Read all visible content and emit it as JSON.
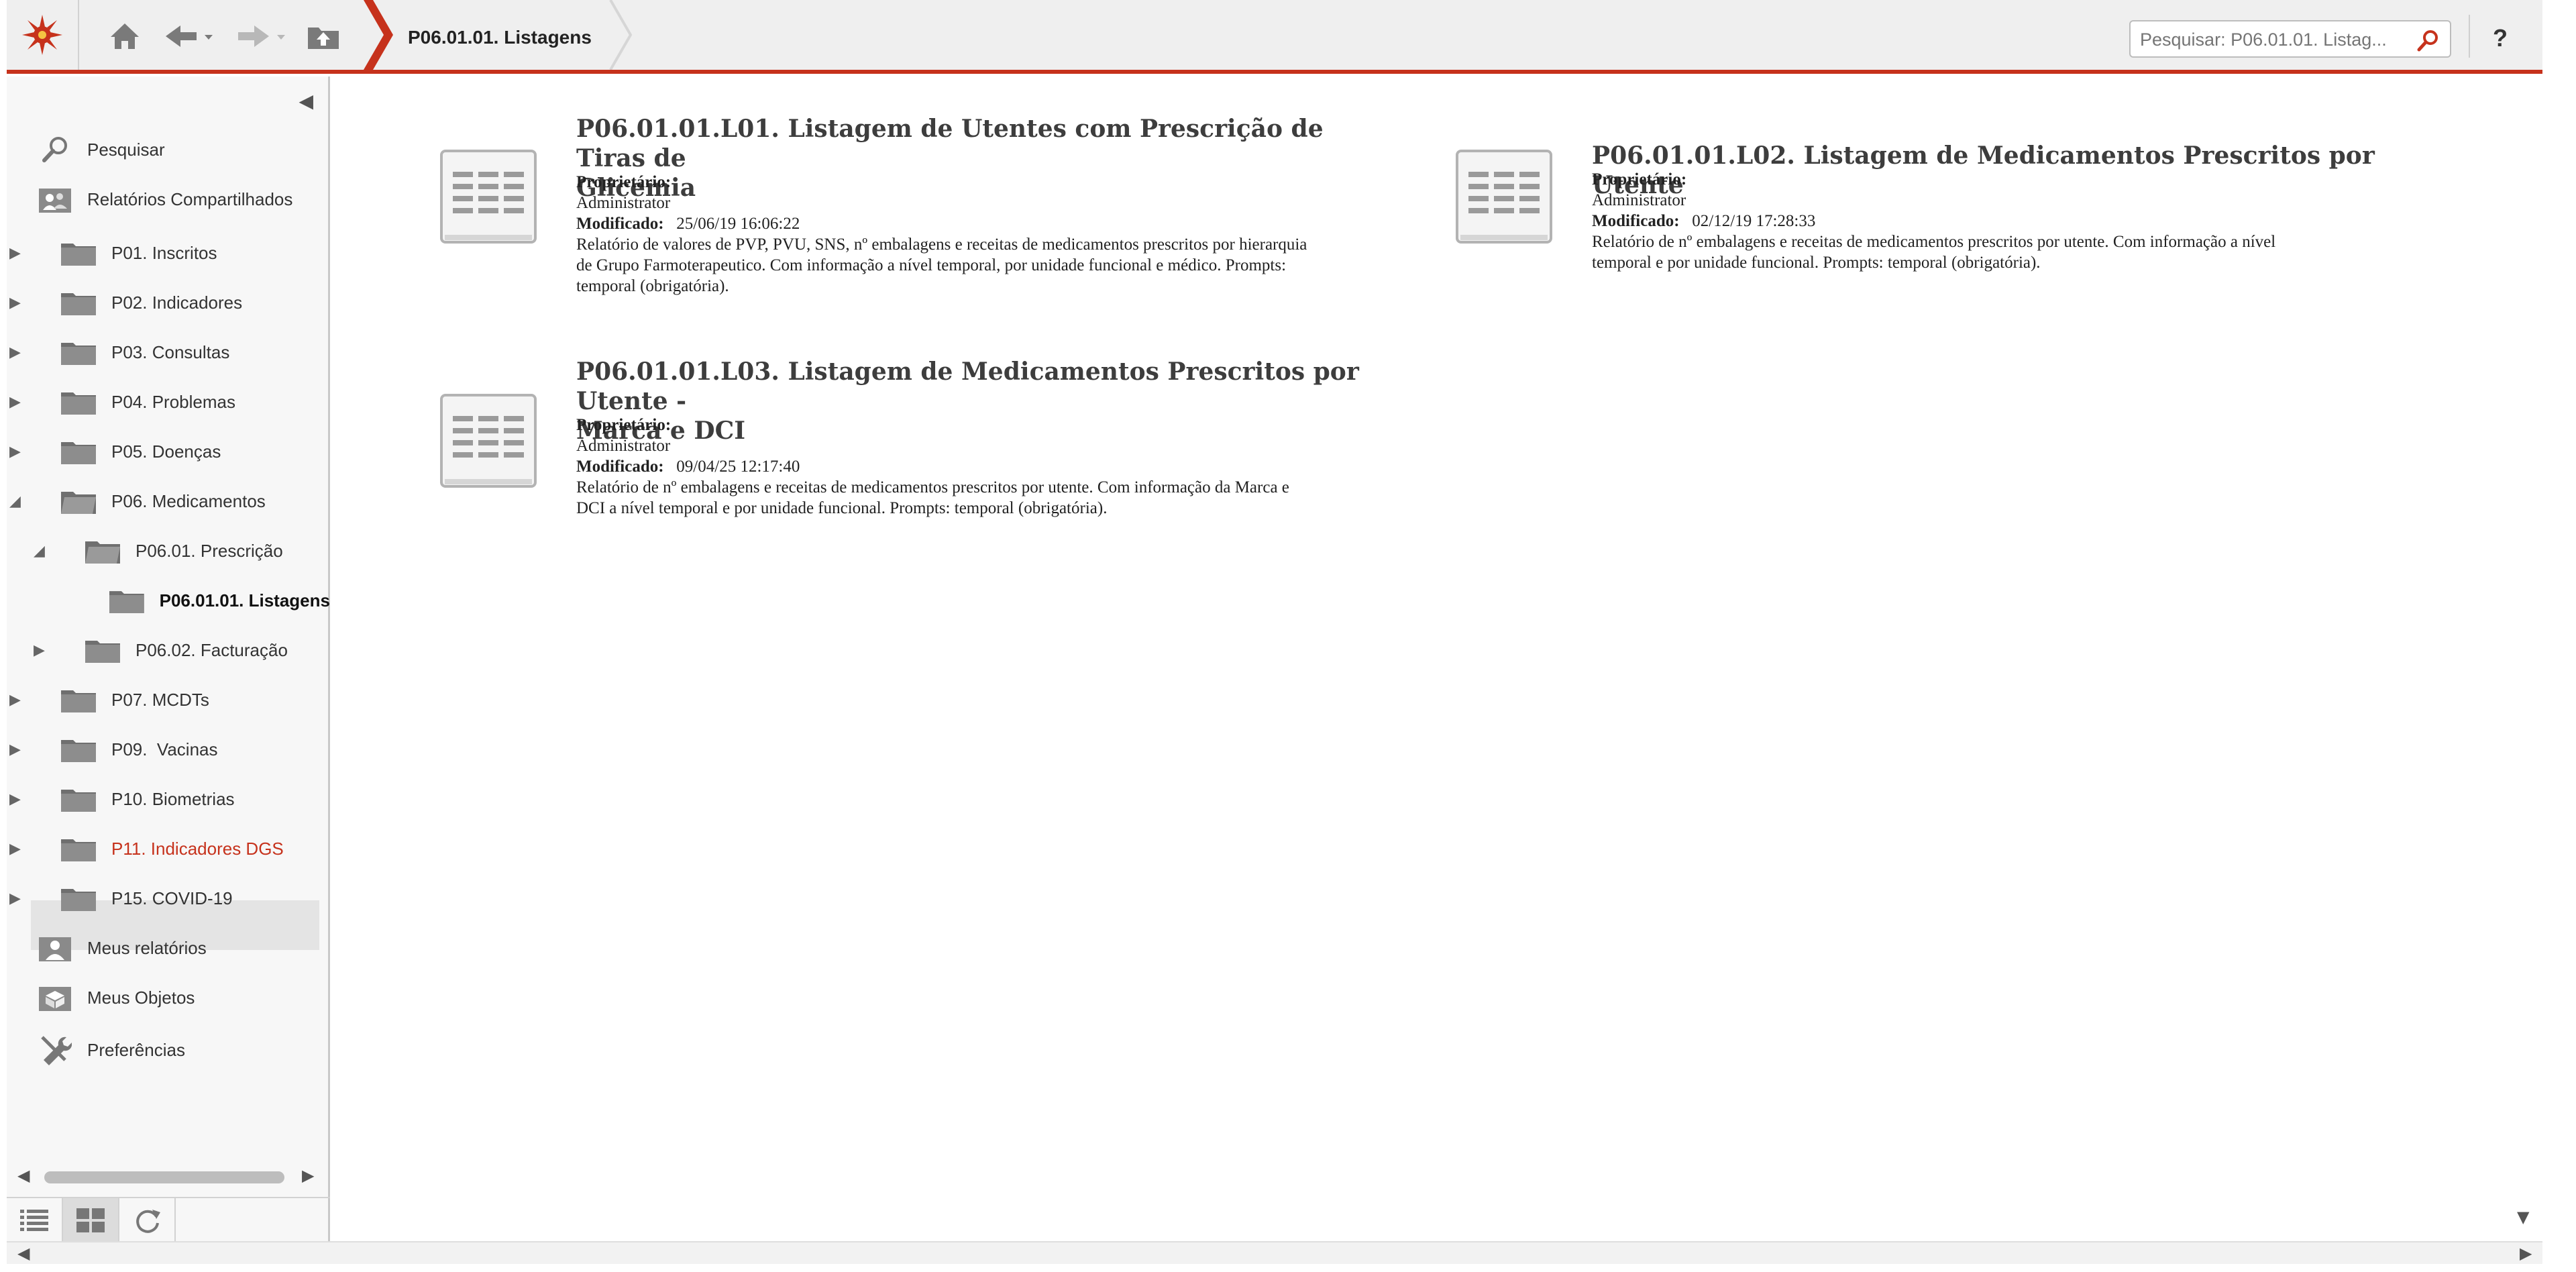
{
  "header": {
    "breadcrumb": "P06.01.01. Listagens",
    "search_placeholder": "Pesquisar: P06.01.01. Listag...",
    "help_label": "?"
  },
  "sidebar": {
    "search_label": "Pesquisar",
    "shared_label": "Relatórios Compartilhados",
    "tree": [
      {
        "label": "P01. Inscritos"
      },
      {
        "label": "P02. Indicadores"
      },
      {
        "label": "P03. Consultas"
      },
      {
        "label": "P04. Problemas"
      },
      {
        "label": "P05. Doenças"
      },
      {
        "label": "P06. Medicamentos"
      },
      {
        "label": "P06.01. Prescrição"
      },
      {
        "label": "P06.01.01. Listagens"
      },
      {
        "label": "P06.02. Facturação"
      },
      {
        "label": "P07. MCDTs"
      },
      {
        "label": "P09.  Vacinas"
      },
      {
        "label": "P10. Biometrias"
      },
      {
        "label": "P11. Indicadores DGS"
      },
      {
        "label": "P15. COVID-19"
      }
    ],
    "my_reports_label": "Meus relatórios",
    "my_objects_label": "Meus Objetos",
    "preferences_label": "Preferências"
  },
  "reports": [
    {
      "title_line1": "P06.01.01.L01. Listagem de Utentes com Prescrição de Tiras de",
      "title_line2": "Glicemia",
      "owner_label": "Proprietário:",
      "owner": "Administrator",
      "modified_label": "Modificado:",
      "modified": "25/06/19 16:06:22",
      "desc_line1": "Relatório de valores de PVP, PVU, SNS, nº embalagens e receitas de medicamentos prescritos por hierarquia",
      "desc_line2": "de Grupo Farmoterapeutico. Com informação a nível temporal, por unidade funcional e médico. Prompts:",
      "desc_line3": "temporal (obrigatória)."
    },
    {
      "title_line1": "P06.01.01.L02. Listagem de Medicamentos Prescritos por Utente",
      "owner_label": "Proprietário:",
      "owner": "Administrator",
      "modified_label": "Modificado:",
      "modified": "02/12/19 17:28:33",
      "desc_line1": "Relatório de nº embalagens e receitas de medicamentos prescritos por utente. Com informação a nível",
      "desc_line2": "temporal e por unidade funcional. Prompts: temporal (obrigatória)."
    },
    {
      "title_line1": "P06.01.01.L03. Listagem de Medicamentos Prescritos por Utente -",
      "title_line2": "Marca e DCI",
      "owner_label": "Proprietário:",
      "owner": "Administrator",
      "modified_label": "Modificado:",
      "modified": "09/04/25 12:17:40",
      "desc_line1": "Relatório de nº embalagens e receitas de medicamentos prescritos por utente. Com informação da Marca e",
      "desc_line2": "DCI a nível temporal e por unidade funcional. Prompts: temporal (obrigatória)."
    }
  ],
  "colors": {
    "accent": "#c6321c",
    "active_item_text": "#c6321c",
    "active_item_bg": "#e4e4e4"
  }
}
